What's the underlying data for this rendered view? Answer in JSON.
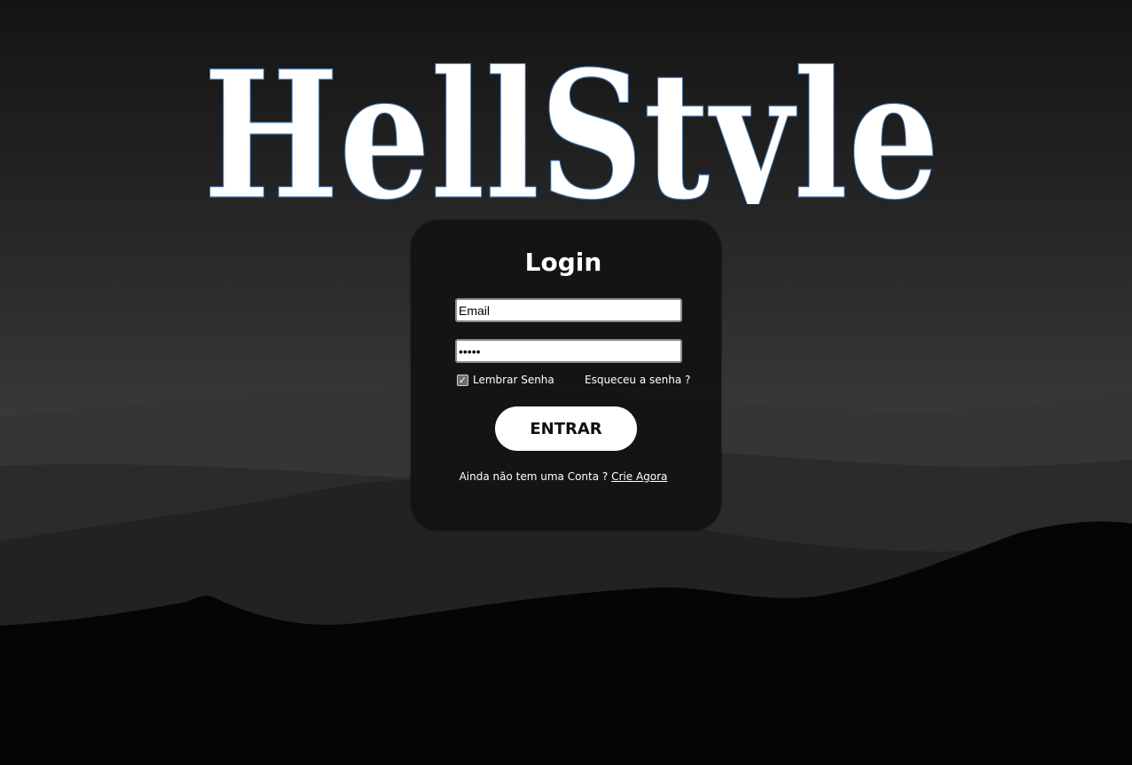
{
  "brand": {
    "logo_text": "HellStyle"
  },
  "login": {
    "title": "Login",
    "email_value": "Email",
    "password_value": "•••••",
    "remember_label": "Lembrar Senha",
    "remember_checked": true,
    "forgot_label": "Esqueceu a senha ?",
    "submit_label": "ENTRAR",
    "signup_prompt": "Ainda não tem uma Conta ?",
    "signup_link": "Crie Agora"
  },
  "colors": {
    "background_top": "#151515",
    "background_mid": "#3a3a3a",
    "card": "#121212",
    "text": "#ffffff",
    "button": "#ffffff"
  },
  "icons": {
    "checkbox": "checkmark-icon"
  }
}
